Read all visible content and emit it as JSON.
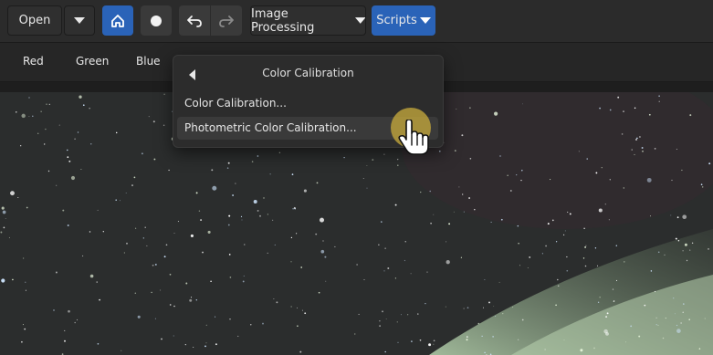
{
  "toolbar": {
    "open_label": "Open",
    "dropdown_icon": "chevron-down-icon",
    "home_icon": "home-icon",
    "record_icon": "circle-icon",
    "undo_icon": "undo-icon",
    "redo_icon": "redo-icon",
    "image_processing_label": "Image Processing",
    "scripts_label": "Scripts",
    "accent_color": "#2a63b8"
  },
  "channels": [
    "Red",
    "Green",
    "Blue"
  ],
  "menu": {
    "title": "Color Calibration",
    "back_icon": "back-arrow-icon",
    "items": [
      {
        "label": "Color Calibration..."
      },
      {
        "label": "Photometric Color Calibration..."
      }
    ]
  },
  "cursor": {
    "icon": "hand-pointer-icon"
  }
}
